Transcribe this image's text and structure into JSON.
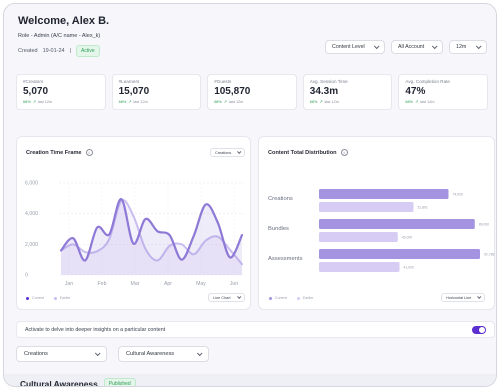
{
  "header": {
    "welcome": "Welcome, Alex B.",
    "role": "Role - Admin (A/C name - Alex_k)",
    "created_label": "Created",
    "created_date": "19-01-24",
    "separator": "|",
    "status": "Active"
  },
  "filters": {
    "content_level": "Content Level",
    "account": "All Account",
    "period": "12m"
  },
  "stats": [
    {
      "label": "#Creators",
      "value": "5,070",
      "pct": "68%",
      "note": "last 12m"
    },
    {
      "label": "#Learners",
      "value": "15,070",
      "pct": "68%",
      "note": "last 12m"
    },
    {
      "label": "#Guests",
      "value": "105,870",
      "pct": "68%",
      "note": "last 12m"
    },
    {
      "label": "Avg. Session Time",
      "value": "34.3m",
      "pct": "68%",
      "note": "last 12m"
    },
    {
      "label": "Avg. Completion Rate",
      "value": "47%",
      "pct": "68%",
      "note": "last 12m"
    }
  ],
  "creation_panel": {
    "title": "Creation Time Frame",
    "dropdown": "Creations",
    "chart_type_dropdown": "Line Chart",
    "legend": [
      "Current",
      "Earlier"
    ]
  },
  "distribution_panel": {
    "title": "Content Total Distribution",
    "chart_type_dropdown": "Horizontal Line",
    "legend": [
      "Current",
      "Earlier"
    ]
  },
  "toggle": {
    "text": "Activate to delve into deeper insights on a particular content"
  },
  "selectors": {
    "type": "Creations",
    "topic": "Cultural Awareness"
  },
  "section": {
    "title": "Cultural Awareness",
    "status": "Published"
  },
  "colors": {
    "accent": "#5b2fd0",
    "series_primary": "#8e79d6",
    "series_secondary": "#c9bdf0",
    "success": "#2f9d57"
  },
  "chart_data": [
    {
      "type": "line",
      "x": [
        "Jan",
        "Feb",
        "Mar",
        "Apr",
        "May",
        "Jun"
      ],
      "yticks": [
        "0",
        "2,000",
        "4,000",
        "6,000"
      ],
      "ylim": [
        0,
        6000
      ],
      "grid": true,
      "series": [
        {
          "name": "Current",
          "values": [
            1600,
            2400,
            950,
            3100,
            2650,
            4950,
            2050,
            3650,
            2850,
            2600,
            1000,
            2550,
            4600,
            3400,
            1150,
            2600
          ]
        },
        {
          "name": "Earlier",
          "values": [
            1600,
            2000,
            1500,
            1550,
            2350,
            4850,
            3850,
            1700,
            950,
            1900,
            2000,
            1350,
            2250,
            2500,
            1650,
            700
          ]
        }
      ],
      "x_positions_note_removed": true
    },
    {
      "type": "bar",
      "orientation": "horizontal",
      "categories": [
        "Creations",
        "Bundles",
        "Assessments"
      ],
      "series": [
        {
          "name": "Current",
          "values": [
            74,
            89,
            92
          ],
          "labels": [
            "74,000",
            "89,000",
            "92,788"
          ]
        },
        {
          "name": "Earlier",
          "values": [
            54,
            45,
            46
          ],
          "labels": [
            "51,891",
            "45,000",
            "41,000"
          ]
        }
      ],
      "xlim": [
        0,
        100
      ]
    }
  ]
}
